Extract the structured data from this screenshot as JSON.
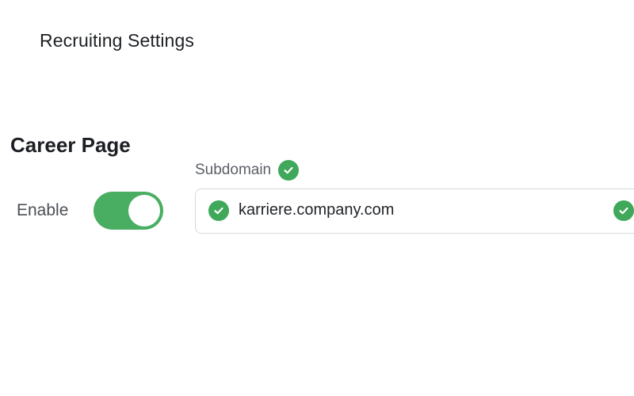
{
  "header": {
    "title": "Recruiting Settings"
  },
  "career_page": {
    "section_title": "Career Page",
    "enable_label": "Enable",
    "enable_toggle": {
      "state": "on",
      "color": "#49ad62"
    },
    "subdomain": {
      "label": "Subdomain",
      "value": "karriere.company.com",
      "status": "valid",
      "status_icon": "check-circle-icon",
      "status_color": "#3fa85a"
    }
  }
}
